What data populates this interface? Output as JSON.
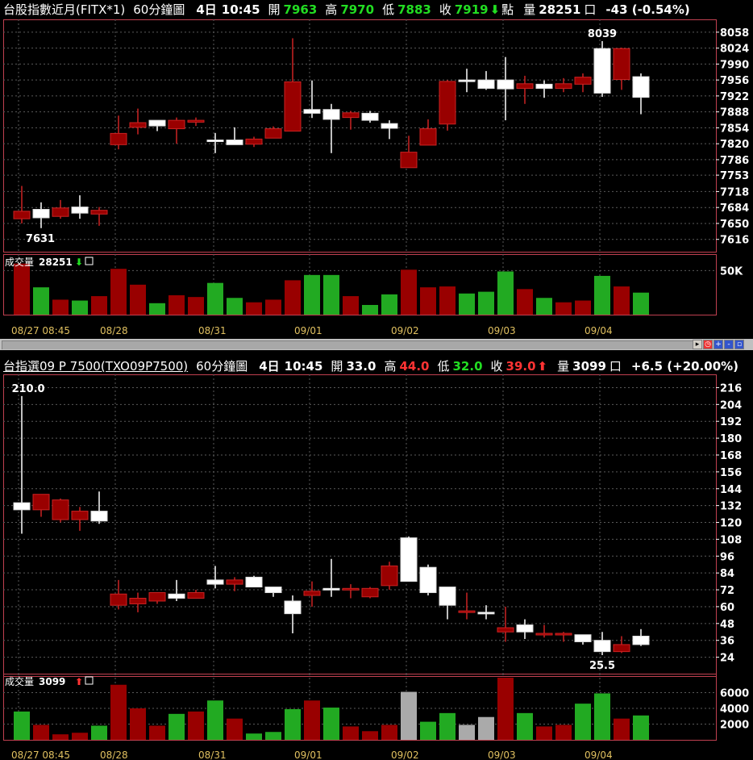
{
  "top": {
    "name": "台股指數近月(FITX*1)",
    "period": "60分鐘圖",
    "date": "4日",
    "time": "10:45",
    "open_label": "開",
    "open": "7963",
    "high_label": "高",
    "high": "7970",
    "low_label": "低",
    "low": "7883",
    "close_label": "收",
    "close": "7919",
    "close_arrow": "⬇",
    "close_suffix": "點",
    "vol_label": "量",
    "vol": "28251",
    "vol_box": "口",
    "change": "-43 (-0.54%)",
    "y_ticks": [
      "8058",
      "8024",
      "7990",
      "7956",
      "7922",
      "7888",
      "7854",
      "7820",
      "7786",
      "7753",
      "7718",
      "7684",
      "7650",
      "7616"
    ],
    "hi_mark": "8039",
    "lo_mark": "7631",
    "vol_title": "成交量",
    "vol_value": "28251",
    "vol_arrow": "⬇",
    "vol_y_ticks": [
      "50K"
    ]
  },
  "bottom": {
    "name": "台指選09 P 7500(TXO09P7500)",
    "period": "60分鐘圖",
    "date": "4日",
    "time": "10:45",
    "open_label": "開",
    "open": "33.0",
    "high_label": "高",
    "high": "44.0",
    "low_label": "低",
    "low": "32.0",
    "close_label": "收",
    "close": "39.0",
    "close_arrow": "⬆",
    "vol_label": "量",
    "vol": "3099",
    "vol_box": "口",
    "change": "+6.5 (+20.00%)",
    "y_ticks": [
      "216",
      "204",
      "192",
      "180",
      "168",
      "156",
      "144",
      "132",
      "120",
      "108",
      "96",
      "84",
      "72",
      "60",
      "48",
      "36",
      "24"
    ],
    "hi_mark": "210.0",
    "lo_mark": "25.5",
    "vol_title": "成交量",
    "vol_value": "3099",
    "vol_arrow": "⬆",
    "vol_y_ticks": [
      "6000",
      "4000",
      "2000"
    ]
  },
  "x_labels": [
    "08/27 08:45",
    "08/28",
    "08/31",
    "09/01",
    "09/02",
    "09/03",
    "09/04"
  ],
  "colors": {
    "up": "#ffffff",
    "down": "#990000",
    "up_vol": "#22aa22",
    "down_vol": "#990000",
    "flat_vol": "#aaaaaa",
    "grid": "#5a5a5a",
    "axis": "#c04050",
    "label_gold": "#e0c060"
  },
  "chart_data": [
    {
      "type": "candlestick",
      "title": "台股指數近月(FITX*1)",
      "ylim": [
        7600,
        8075
      ],
      "x_labels": [
        "08/27 08:45",
        "08/28",
        "08/31",
        "09/01",
        "09/02",
        "09/03",
        "09/04"
      ],
      "candles": [
        [
          7676,
          7730,
          7650,
          7660
        ],
        [
          7662,
          7695,
          7640,
          7680
        ],
        [
          7683,
          7700,
          7660,
          7665
        ],
        [
          7672,
          7710,
          7660,
          7685
        ],
        [
          7678,
          7685,
          7645,
          7670
        ],
        [
          7842,
          7880,
          7808,
          7818
        ],
        [
          7865,
          7895,
          7840,
          7855
        ],
        [
          7858,
          7870,
          7847,
          7870
        ],
        [
          7870,
          7876,
          7820,
          7852
        ],
        [
          7870,
          7876,
          7858,
          7866
        ],
        [
          7828,
          7843,
          7800,
          7828
        ],
        [
          7818,
          7855,
          7818,
          7828
        ],
        [
          7830,
          7835,
          7813,
          7819
        ],
        [
          7852,
          7857,
          7832,
          7832
        ],
        [
          7952,
          8045,
          7850,
          7847
        ],
        [
          7885,
          7955,
          7875,
          7893
        ],
        [
          7872,
          7905,
          7800,
          7893
        ],
        [
          7886,
          7890,
          7850,
          7876
        ],
        [
          7870,
          7890,
          7865,
          7885
        ],
        [
          7853,
          7870,
          7830,
          7863
        ],
        [
          7802,
          7837,
          7769,
          7769
        ],
        [
          7852,
          7872,
          7817,
          7817
        ],
        [
          7953,
          7956,
          7848,
          7862
        ],
        [
          7956,
          7980,
          7930,
          7956
        ],
        [
          7938,
          7975,
          7935,
          7956
        ],
        [
          7937,
          8005,
          7870,
          7956
        ],
        [
          7948,
          7965,
          7905,
          7938
        ],
        [
          7938,
          7955,
          7918,
          7947
        ],
        [
          7948,
          7960,
          7930,
          7938
        ],
        [
          7962,
          7970,
          7930,
          7947
        ],
        [
          7928,
          8039,
          7920,
          8023
        ],
        [
          8023,
          8025,
          7935,
          7957
        ],
        [
          7919,
          7970,
          7883,
          7963
        ]
      ],
      "volume_ylim": [
        0,
        65000
      ],
      "volume": [
        58000,
        31000,
        17000,
        16000,
        21000,
        52000,
        34000,
        13000,
        22000,
        20000,
        36000,
        19000,
        14000,
        17000,
        39000,
        45000,
        45000,
        21000,
        11000,
        23000,
        51000,
        31000,
        32000,
        24000,
        26000,
        49000,
        29000,
        19000,
        14000,
        16000,
        44000,
        32000,
        25000
      ]
    },
    {
      "type": "candlestick",
      "title": "台指選09 P 7500(TXO09P7500)",
      "ylim": [
        14,
        222
      ],
      "x_labels": [
        "08/27 08:45",
        "08/28",
        "08/31",
        "09/01",
        "09/02",
        "09/03",
        "09/04"
      ],
      "candles": [
        [
          129,
          210,
          112,
          134
        ],
        [
          140,
          140,
          124,
          129
        ],
        [
          136,
          137,
          120,
          122
        ],
        [
          128,
          131,
          114,
          122
        ],
        [
          121,
          142,
          119,
          128
        ],
        [
          69,
          79,
          58,
          61
        ],
        [
          66,
          70,
          56,
          62
        ],
        [
          70,
          70,
          62,
          64
        ],
        [
          66,
          79,
          64,
          69
        ],
        [
          70,
          72,
          66,
          66
        ],
        [
          76,
          89,
          73,
          79
        ],
        [
          79,
          81,
          71,
          76
        ],
        [
          74,
          82,
          74,
          81
        ],
        [
          70,
          74,
          67,
          74
        ],
        [
          55,
          68,
          41,
          64
        ],
        [
          71,
          78,
          60,
          68
        ],
        [
          72,
          94,
          67,
          73
        ],
        [
          73,
          76,
          66,
          72
        ],
        [
          73,
          74,
          66,
          67
        ],
        [
          89,
          92,
          72,
          75
        ],
        [
          78,
          110,
          78,
          109
        ],
        [
          70,
          90,
          68,
          88
        ],
        [
          61,
          74,
          51,
          74
        ],
        [
          57,
          70,
          51,
          56
        ],
        [
          56,
          61,
          51,
          56
        ],
        [
          45,
          60,
          35,
          42
        ],
        [
          42,
          51,
          37,
          47
        ],
        [
          41,
          47,
          38,
          40
        ],
        [
          41,
          42,
          35,
          40
        ],
        [
          35,
          40,
          33,
          40
        ],
        [
          28,
          42,
          25.5,
          36
        ],
        [
          33,
          39,
          27,
          28
        ],
        [
          33,
          44,
          32,
          39
        ]
      ],
      "volume_ylim": [
        0,
        8000
      ],
      "volume": [
        3600,
        1900,
        700,
        900,
        1800,
        7000,
        4000,
        1800,
        3300,
        3600,
        5000,
        2700,
        800,
        1000,
        3900,
        5000,
        4100,
        1700,
        1100,
        1900,
        6100,
        2300,
        3400,
        1900,
        2900,
        7900,
        3400,
        1700,
        1900,
        4600,
        5900,
        2700,
        3099
      ]
    }
  ]
}
